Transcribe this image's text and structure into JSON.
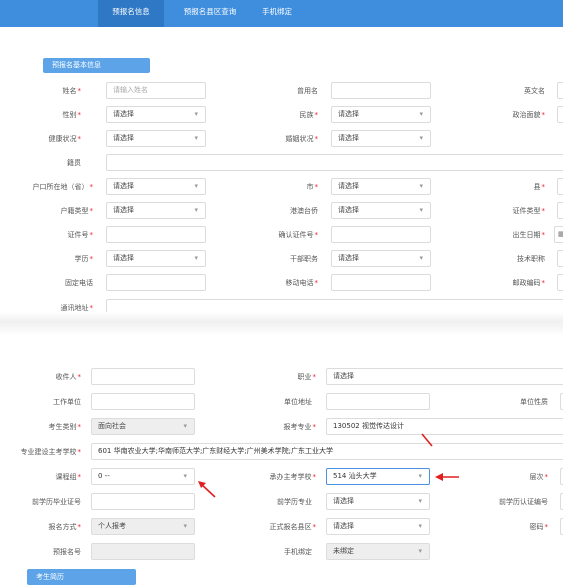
{
  "tabs": [
    {
      "label": "预报名信息",
      "active": true
    },
    {
      "label": "预报名县区查询",
      "active": false
    },
    {
      "label": "手机绑定",
      "active": false
    }
  ],
  "section_basic": "预报名基本信息",
  "section_resume": "考生简历",
  "top_form": {
    "name": {
      "label": "姓名",
      "required": true,
      "placeholder": "请输入姓名"
    },
    "used_name": {
      "label": "曾用名",
      "required": false
    },
    "english_name": {
      "label": "英文名",
      "required": false
    },
    "gender": {
      "label": "性别",
      "required": true,
      "value": "请选择"
    },
    "ethnicity": {
      "label": "民族",
      "required": true,
      "value": "请选择"
    },
    "political": {
      "label": "政治面貌",
      "required": true
    },
    "health": {
      "label": "健康状况",
      "required": true,
      "value": "请选择"
    },
    "marital": {
      "label": "婚姻状况",
      "required": true,
      "value": "请选择"
    },
    "native_place": {
      "label": "籍贯",
      "required": false
    },
    "hukou_province": {
      "label": "户口所在地（省）",
      "required": true,
      "value": "请选择"
    },
    "city": {
      "label": "市",
      "required": true,
      "value": "请选择"
    },
    "county": {
      "label": "县",
      "required": true
    },
    "hukou_type": {
      "label": "户籍类型",
      "required": true,
      "value": "请选择"
    },
    "overseas": {
      "label": "港澳台侨",
      "required": false,
      "value": "请选择"
    },
    "id_type": {
      "label": "证件类型",
      "required": true
    },
    "id_number": {
      "label": "证件号",
      "required": true
    },
    "confirm_id": {
      "label": "确认证件号",
      "required": true
    },
    "birth_date": {
      "label": "出生日期",
      "required": true
    },
    "education": {
      "label": "学历",
      "required": true,
      "value": "请选择"
    },
    "cadre_post": {
      "label": "干部职务",
      "required": false,
      "value": "请选择"
    },
    "tech_title": {
      "label": "技术职称",
      "required": false
    },
    "landline": {
      "label": "固定电话",
      "required": false
    },
    "mobile": {
      "label": "移动电话",
      "required": true
    },
    "postcode": {
      "label": "邮政编码",
      "required": true
    },
    "address": {
      "label": "通讯地址",
      "required": true
    }
  },
  "bottom_form": {
    "recipient": {
      "label": "收件人",
      "required": true
    },
    "occupation": {
      "label": "职业",
      "required": true,
      "value": "请选择"
    },
    "employer": {
      "label": "工作单位",
      "required": false
    },
    "employer_address": {
      "label": "单位地址",
      "required": false
    },
    "employer_type": {
      "label": "单位性质",
      "required": false
    },
    "candidate_type": {
      "label": "考生类别",
      "required": true,
      "value": "面向社会"
    },
    "major": {
      "label": "报考专业",
      "required": true,
      "value": "130502 视觉传达设计"
    },
    "main_school": {
      "label": "专业建设主考学校",
      "required": true,
      "value": "601 华南农业大学;华南师范大学;广东财经大学;广州美术学院;广东工业大学"
    },
    "course_group": {
      "label": "课程组",
      "required": true,
      "value": "0 --"
    },
    "host_school": {
      "label": "承办主考学校",
      "required": true,
      "value": "514 汕头大学"
    },
    "level": {
      "label": "层次",
      "required": true
    },
    "prev_diploma_no": {
      "label": "前学历毕业证号",
      "required": false
    },
    "prev_major": {
      "label": "前学历专业",
      "required": false,
      "value": "请选择"
    },
    "prev_cert_no": {
      "label": "前学历认证编号",
      "required": false
    },
    "signup_method": {
      "label": "报名方式",
      "required": true,
      "value": "个人报考"
    },
    "formal_county": {
      "label": "正式报名县区",
      "required": true,
      "value": "请选择"
    },
    "password": {
      "label": "密码",
      "required": true
    },
    "pre_signup_no": {
      "label": "预报名号",
      "required": false
    },
    "phone_binding": {
      "label": "手机绑定",
      "required": false,
      "value": "未绑定"
    }
  },
  "colors": {
    "nav": "#3f8ede",
    "nav_active": "#2f78c5",
    "section_button": "#5ca3e8",
    "required": "#e23333",
    "arrow": "#e02020"
  }
}
